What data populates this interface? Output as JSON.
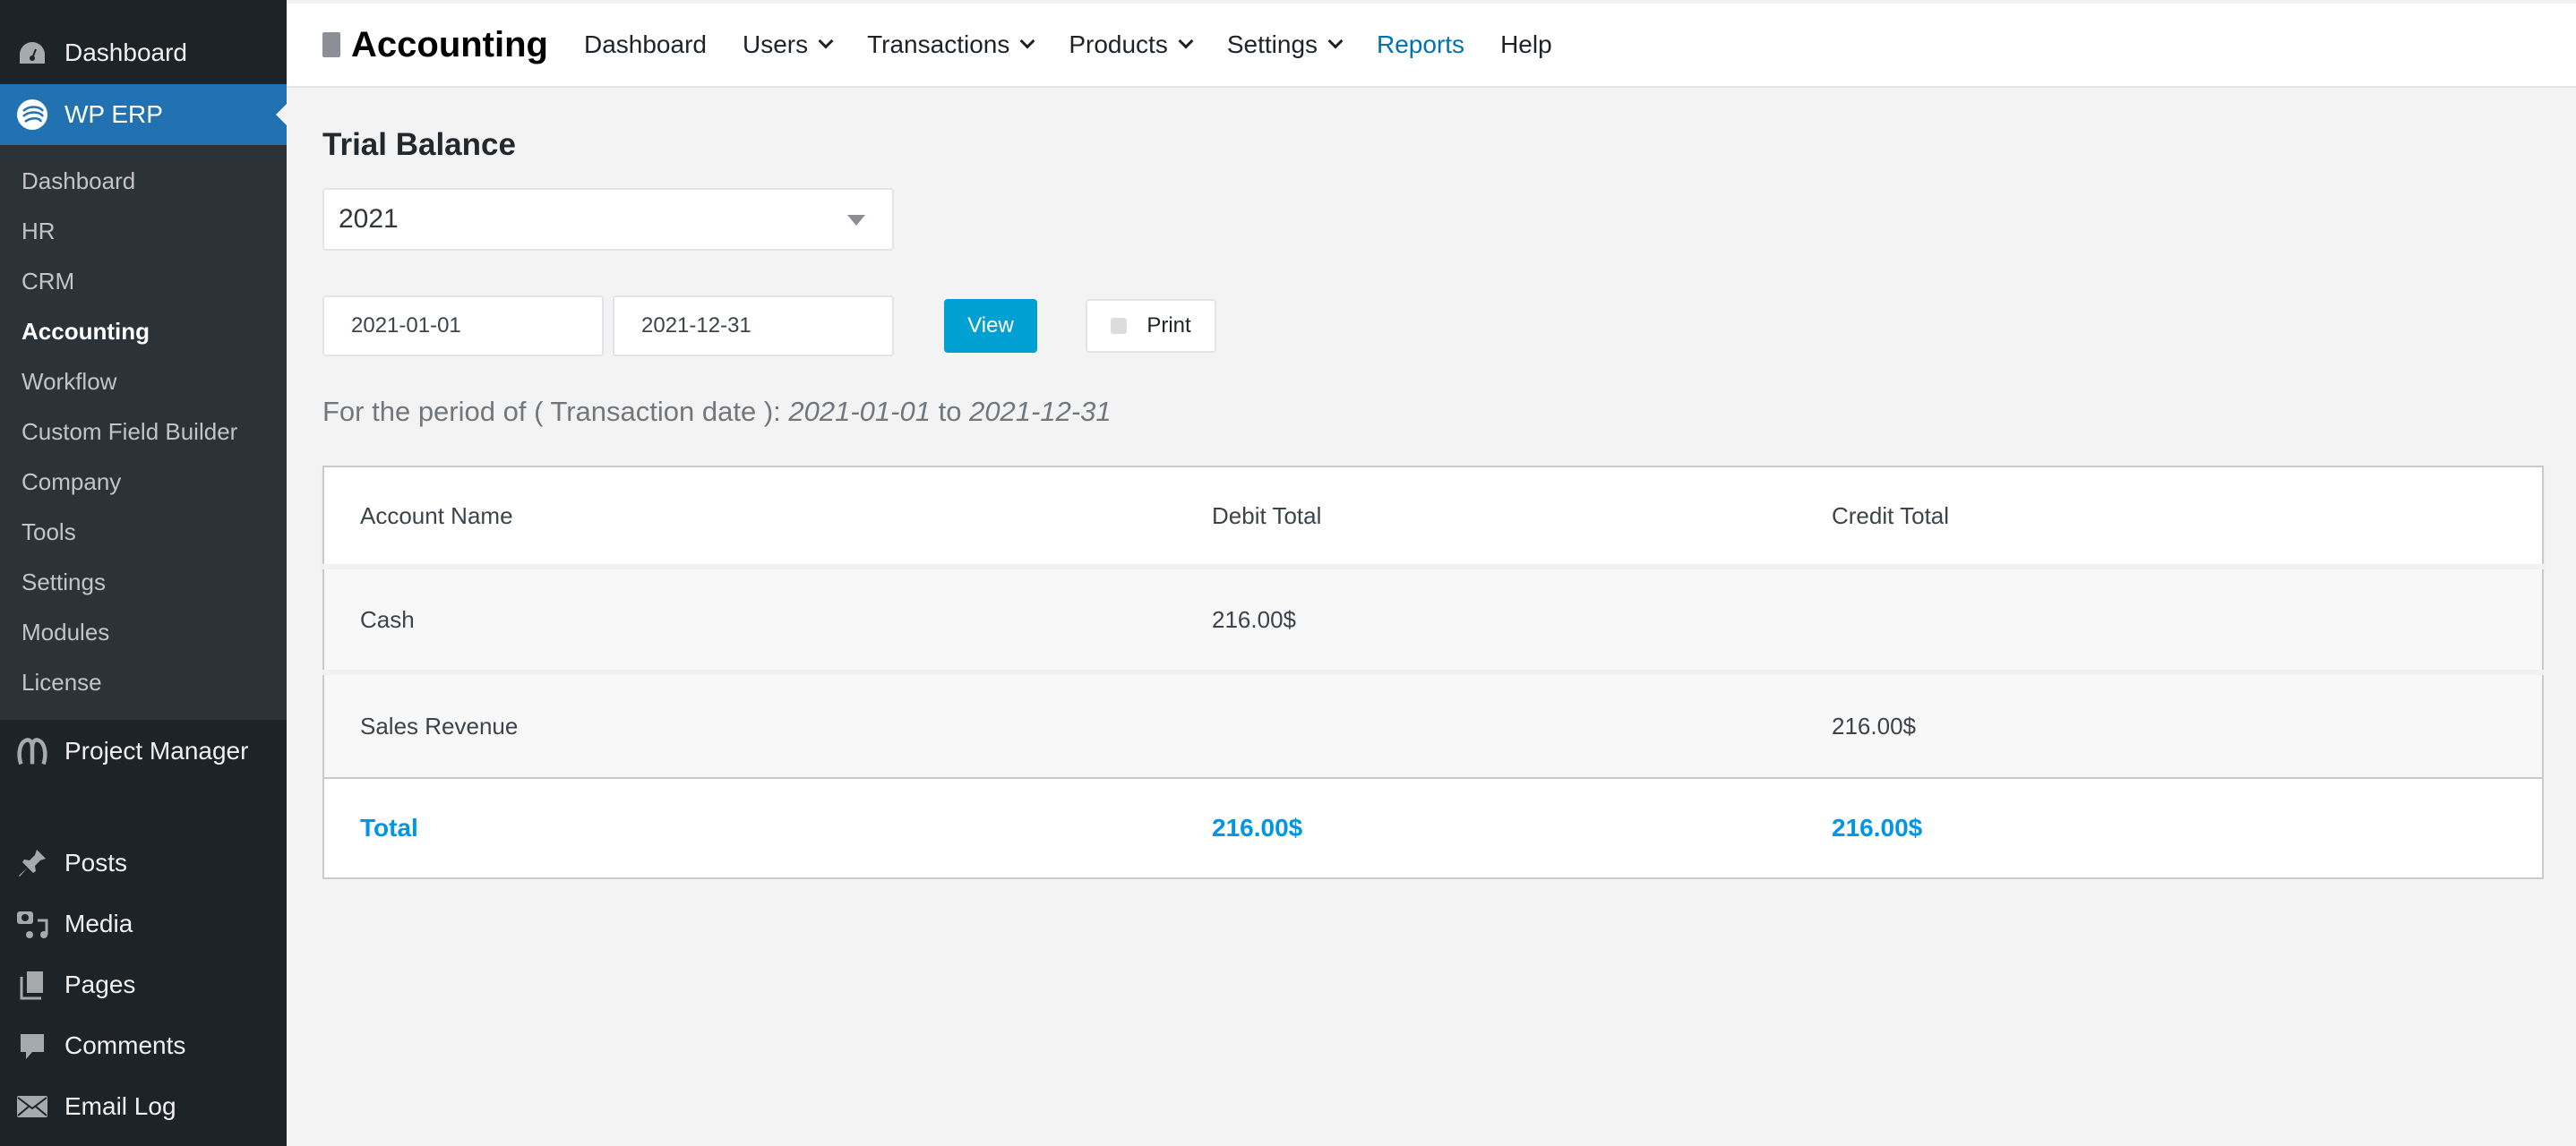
{
  "sidebar": {
    "top": [
      {
        "label": "Dashboard",
        "icon": "dashboard-gauge-icon"
      },
      {
        "label": "WP ERP",
        "icon": "wp-erp-logo-icon"
      }
    ],
    "submenu": [
      "Dashboard",
      "HR",
      "CRM",
      "Accounting",
      "Workflow",
      "Custom Field Builder",
      "Company",
      "Tools",
      "Settings",
      "Modules",
      "License"
    ],
    "current_submenu": "Accounting",
    "project_manager": "Project Manager",
    "lower": [
      {
        "label": "Posts",
        "icon": "pushpin-icon"
      },
      {
        "label": "Media",
        "icon": "media-icon"
      },
      {
        "label": "Pages",
        "icon": "pages-icon"
      },
      {
        "label": "Comments",
        "icon": "comment-icon"
      },
      {
        "label": "Email Log",
        "icon": "envelope-icon"
      }
    ]
  },
  "header": {
    "title": "Accounting",
    "nav": [
      {
        "label": "Dashboard",
        "dropdown": false
      },
      {
        "label": "Users",
        "dropdown": true
      },
      {
        "label": "Transactions",
        "dropdown": true
      },
      {
        "label": "Products",
        "dropdown": true
      },
      {
        "label": "Settings",
        "dropdown": true
      },
      {
        "label": "Reports",
        "dropdown": false,
        "active": true
      },
      {
        "label": "Help",
        "dropdown": false
      }
    ]
  },
  "report": {
    "title": "Trial Balance",
    "year": "2021",
    "start_date": "2021-01-01",
    "end_date": "2021-12-31",
    "view_label": "View",
    "print_label": "Print",
    "period_prefix": "For the period of ( Transaction date ):",
    "period_start": "2021-01-01",
    "period_to": "to",
    "period_end": "2021-12-31"
  },
  "table": {
    "columns": [
      "Account Name",
      "Debit Total",
      "Credit Total"
    ],
    "rows": [
      [
        "Cash",
        "216.00$",
        ""
      ],
      [
        "Sales Revenue",
        "",
        "216.00$"
      ]
    ],
    "total": [
      "Total",
      "216.00$",
      "216.00$"
    ]
  },
  "colors": {
    "accent": "#2271b1",
    "button": "#00a0d2",
    "total": "#0096e6",
    "active_nav": "#0073aa"
  }
}
